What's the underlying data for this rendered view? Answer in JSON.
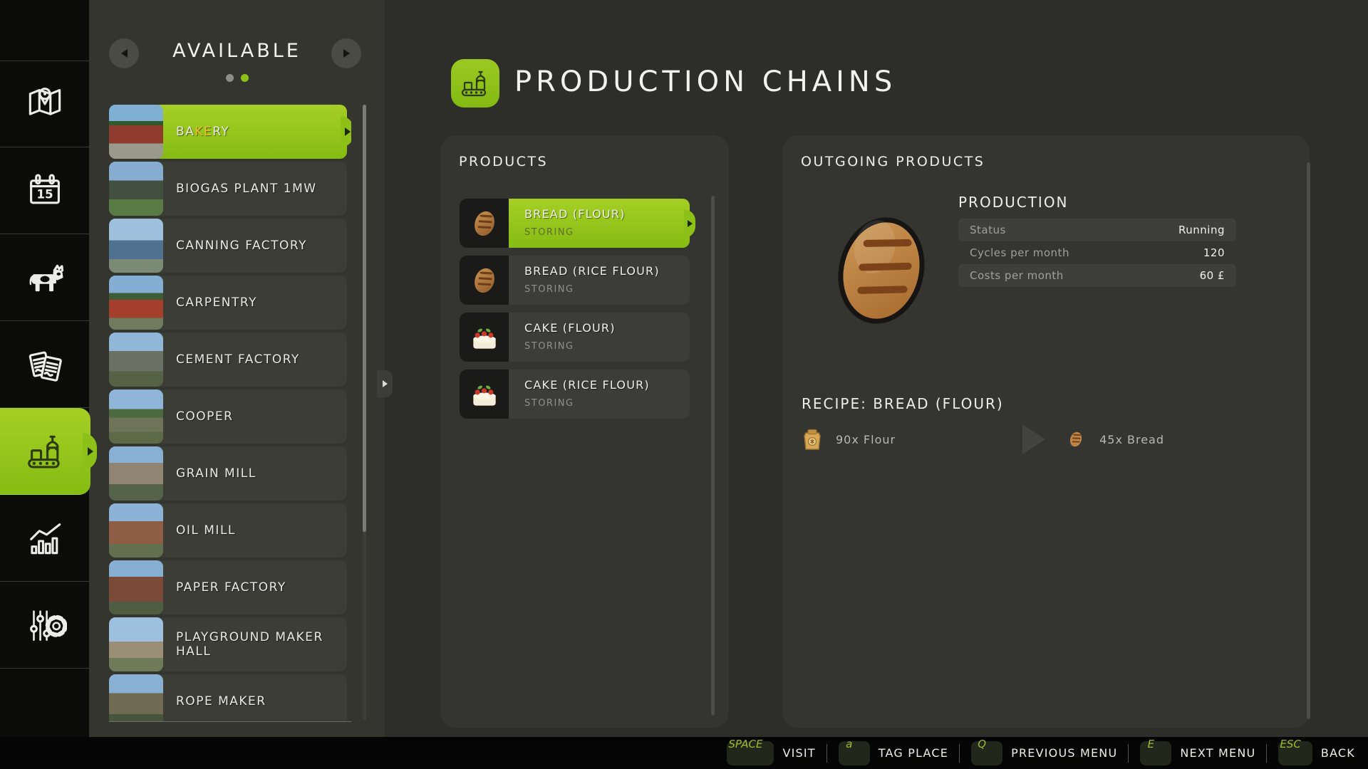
{
  "sidebar": {
    "calendar_day": "15",
    "items": [
      {
        "icon": "map-icon"
      },
      {
        "icon": "calendar-icon"
      },
      {
        "icon": "animals-icon"
      },
      {
        "icon": "contracts-icon"
      },
      {
        "icon": "production-icon",
        "selected": true
      },
      {
        "icon": "statistics-icon"
      },
      {
        "icon": "settings-icon"
      }
    ]
  },
  "available_panel": {
    "title": "AVAILABLE",
    "page_indicator": {
      "total_pages": 2,
      "active_page": 2
    },
    "buildings": [
      {
        "label_pre": "BA",
        "label_hl": "KE",
        "label_post": "RY",
        "selected": true
      },
      {
        "label_pre": "BIOGAS PLANT 1MW",
        "label_hl": "",
        "label_post": ""
      },
      {
        "label_pre": "CANNING FACTORY",
        "label_hl": "",
        "label_post": ""
      },
      {
        "label_pre": "CARPENTRY",
        "label_hl": "",
        "label_post": ""
      },
      {
        "label_pre": "CEMENT FACTORY",
        "label_hl": "",
        "label_post": ""
      },
      {
        "label_pre": "COOPER",
        "label_hl": "",
        "label_post": ""
      },
      {
        "label_pre": "GRAIN MILL",
        "label_hl": "",
        "label_post": ""
      },
      {
        "label_pre": "OIL MILL",
        "label_hl": "",
        "label_post": ""
      },
      {
        "label_pre": "PAPER FACTORY",
        "label_hl": "",
        "label_post": ""
      },
      {
        "label_pre": "PLAYGROUND MAKER HALL",
        "label_hl": "",
        "label_post": ""
      },
      {
        "label_pre": "ROPE MAKER",
        "label_hl": "",
        "label_post": ""
      }
    ]
  },
  "header": {
    "title": "PRODUCTION CHAINS",
    "icon": "production-chains-icon"
  },
  "products_panel": {
    "title": "PRODUCTS",
    "items": [
      {
        "name": "BREAD (FLOUR)",
        "status": "STORING",
        "icon": "bread-icon",
        "selected": true
      },
      {
        "name": "BREAD (RICE FLOUR)",
        "status": "STORING",
        "icon": "bread-icon"
      },
      {
        "name": "CAKE (FLOUR)",
        "status": "STORING",
        "icon": "cake-icon"
      },
      {
        "name": "CAKE (RICE FLOUR)",
        "status": "STORING",
        "icon": "cake-icon"
      }
    ]
  },
  "outgoing_panel": {
    "title": "OUTGOING PRODUCTS",
    "hero_icon": "bread-illustration",
    "production": {
      "title": "PRODUCTION",
      "rows": [
        {
          "label": "Status",
          "value": "Running"
        },
        {
          "label": "Cycles per month",
          "value": "120"
        },
        {
          "label": "Costs per month",
          "value": "60 £"
        }
      ]
    },
    "recipe": {
      "title": "RECIPE: BREAD (FLOUR)",
      "input": {
        "qty": "90x",
        "name": "Flour",
        "icon": "flour-sack-icon"
      },
      "output": {
        "qty": "45x",
        "name": "Bread",
        "icon": "bread-icon"
      }
    }
  },
  "hotkey_bar": {
    "hints": [
      {
        "key": "SPACE",
        "action": "VISIT"
      },
      {
        "key": "a",
        "action": "TAG PLACE"
      },
      {
        "key": "Q",
        "action": "PREVIOUS MENU"
      },
      {
        "key": "E",
        "action": "NEXT MENU"
      },
      {
        "key": "ESC",
        "action": "BACK"
      }
    ]
  },
  "colors": {
    "accent_green": "#8ec117",
    "search_highlight": "#f2c12f",
    "key_label_green": "#9dbd2e",
    "panel_bg": "#343431",
    "sidebar_bg": "#0b0b0a"
  }
}
